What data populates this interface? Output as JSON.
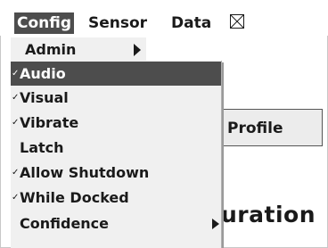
{
  "menubar": {
    "items": [
      {
        "label": "Config"
      },
      {
        "label": "Sensor"
      },
      {
        "label": "Data"
      }
    ]
  },
  "submenu": {
    "header_label": "Admin"
  },
  "dropdown": {
    "check_glyph": "✓",
    "items": [
      {
        "label": "Audio",
        "checked": true,
        "selected": true
      },
      {
        "label": "Visual",
        "checked": true
      },
      {
        "label": "Vibrate",
        "checked": true
      },
      {
        "label": "Latch",
        "checked": false
      },
      {
        "label": "Allow Shutdown",
        "checked": true
      },
      {
        "label": "While Docked",
        "checked": true
      },
      {
        "label": "Confidence",
        "checked": false,
        "has_submenu": true
      }
    ]
  },
  "background": {
    "tab_label": "Profile",
    "heading_fragment": "uration"
  },
  "colors": {
    "highlight": "#4d4d4d",
    "menu_bg": "#f0f0f0"
  }
}
